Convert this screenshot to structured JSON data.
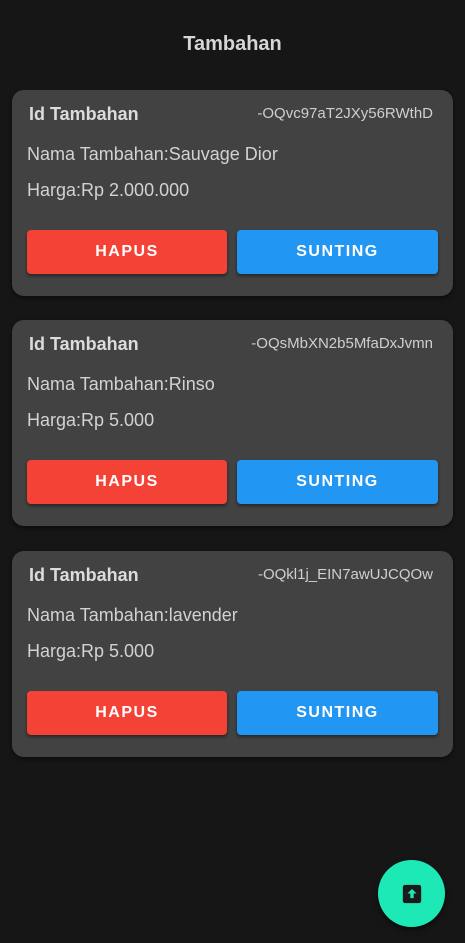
{
  "header": {
    "title": "Tambahan"
  },
  "items": [
    {
      "id_label": "Id Tambahan",
      "id_value": "-OQvc97aT2JXy56RWthD",
      "name_text": "Nama Tambahan:Sauvage Dior",
      "price_text": "Harga:Rp 2.000.000",
      "delete_label": "HAPUS",
      "edit_label": "SUNTING"
    },
    {
      "id_label": "Id Tambahan",
      "id_value": "-OQsMbXN2b5MfaDxJvmn",
      "name_text": "Nama Tambahan:Rinso",
      "price_text": "Harga:Rp 5.000",
      "delete_label": "HAPUS",
      "edit_label": "SUNTING"
    },
    {
      "id_label": "Id Tambahan",
      "id_value": "-OQkl1j_EIN7awUJCQOw",
      "name_text": "Nama Tambahan:lavender",
      "price_text": "Harga:Rp 5.000",
      "delete_label": "HAPUS",
      "edit_label": "SUNTING"
    }
  ],
  "fab": {
    "icon": "upload-icon"
  },
  "colors": {
    "background": "#161616",
    "card": "#424242",
    "delete_button": "#f44336",
    "edit_button": "#2196f3",
    "fab": "#1de9b6"
  }
}
